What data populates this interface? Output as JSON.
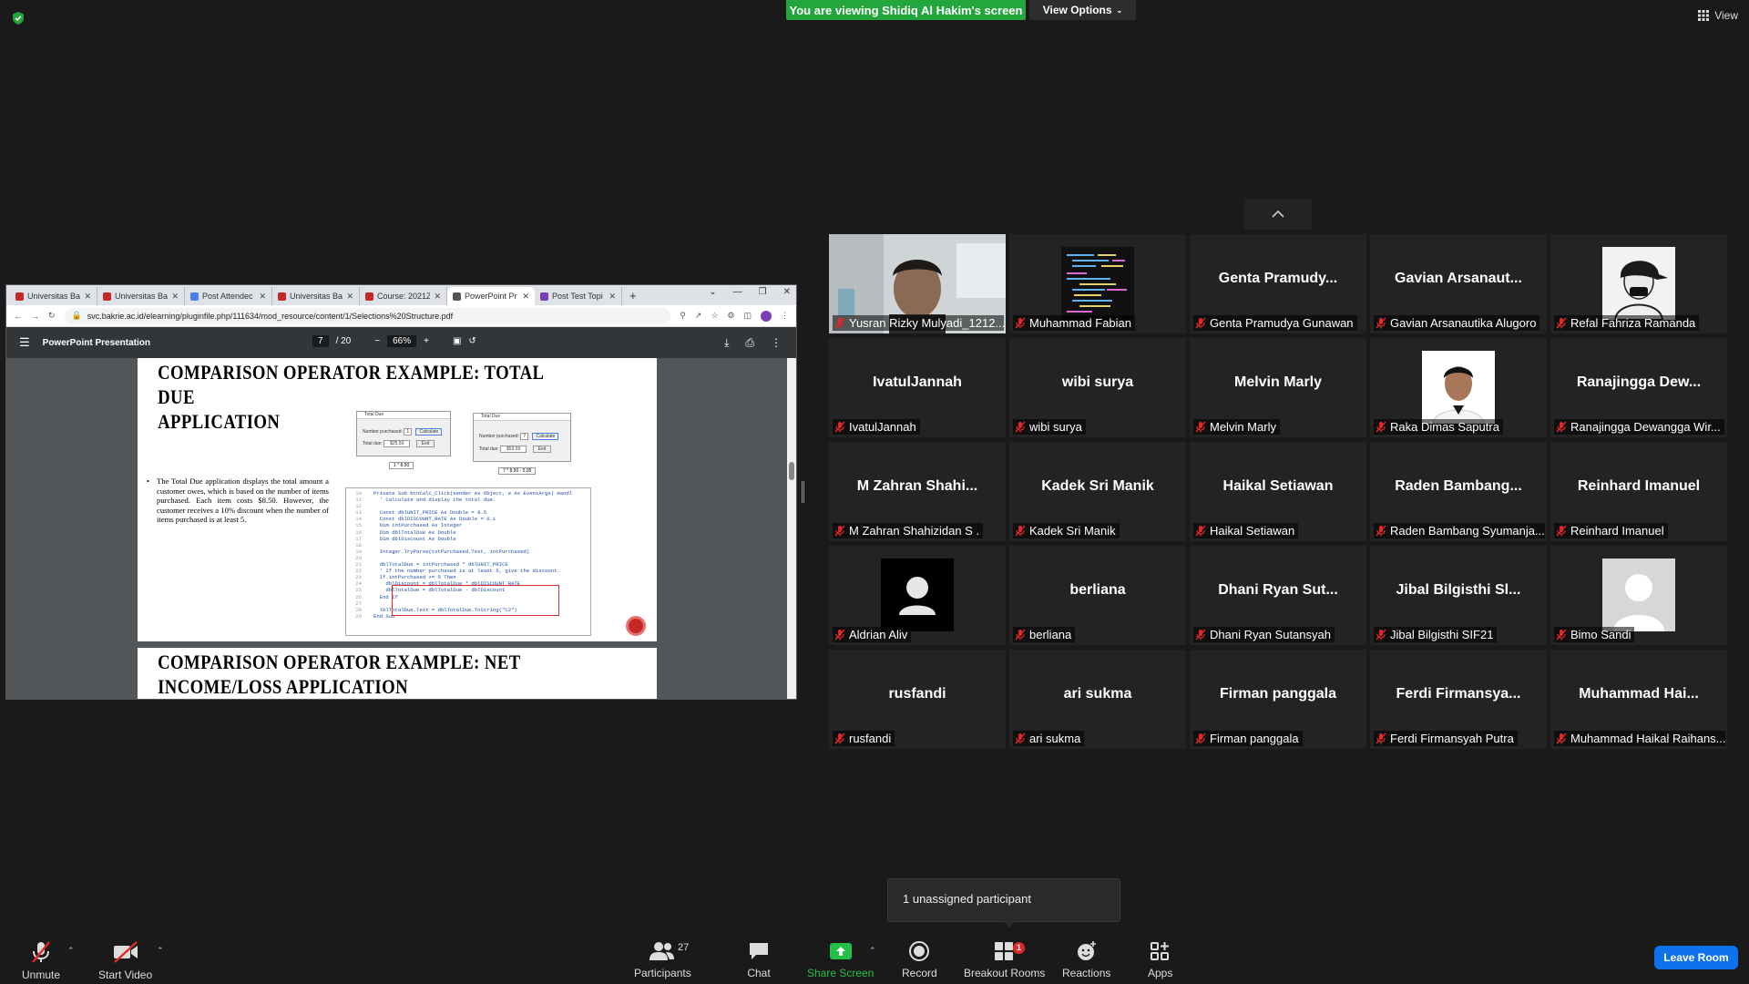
{
  "banner": {
    "viewing_text": "You are viewing Shidiq Al Hakim's screen",
    "view_options": "View Options"
  },
  "top_right": {
    "view_label": "View"
  },
  "browser": {
    "tabs": [
      {
        "label": "Universitas Ba",
        "color": "#c62828"
      },
      {
        "label": "Universitas Ba",
        "color": "#c62828"
      },
      {
        "label": "Post Attendec",
        "color": "#4a7ee8"
      },
      {
        "label": "Universitas Ba",
        "color": "#c62828"
      },
      {
        "label": "Course: 2021Z",
        "color": "#c62828"
      },
      {
        "label": "PowerPoint Pr",
        "color": "#555555"
      },
      {
        "label": "Post Test Topi",
        "color": "#7b3fb5"
      }
    ],
    "url": "svc.bakrie.ac.id/elearning/pluginfile.php/111634/mod_resource/content/1/Selections%20Structure.pdf"
  },
  "pdf": {
    "title": "PowerPoint Presentation",
    "page_current": "7",
    "page_total": "/ 20",
    "zoom": "66%",
    "slide1_title_1": "COMPARISON OPERATOR EXAMPLE: TOTAL DUE",
    "slide1_title_2": "APPLICATION",
    "bullet": "The Total Due application displays the total amount a customer owes, which is based on the number of items purchased. Each item costs $8.50. However, the customer receives a 10% discount when the number of items purchased is at least 5.",
    "dialog_title": "Total Due",
    "dialog_num_label": "Number purchased:",
    "dialog_due_label": "Total due:",
    "dialog_calc": "Calculate",
    "dialog_exit": "Exit",
    "dialog1_value": "1",
    "dialog1_due": "$25.50",
    "dialog2_value": "7",
    "dialog2_due": "$53.55",
    "caption1": "1 * 8.50",
    "caption2": "7 * 8.50 - 5.95",
    "code_line_numbers": "10\n11\n12\n13\n14\n15\n16\n17\n18\n19\n20\n21\n22\n23\n24\n25\n26\n27\n28\n29",
    "code": "Private Sub btnCalc_Click(sender As Object, e As EventArgs) Handl\n  ' Calculate and display the total due.\n\n  Const dblUNIT_PRICE As Double = 8.5\n  Const dblDISCOUNT_RATE As Double = 0.1\n  Dim intPurchased As Integer\n  Dim dblTotalDue As Double\n  Dim dblDiscount As Double\n\n  Integer.TryParse(txtPurchased.Text, intPurchased)\n\n  dblTotalDue = intPurchased * dblUNIT_PRICE\n  ' If the number purchased is at least 5, give the discount.\n  If intPurchased >= 5 Then\n    dblDiscount = dblTotalDue * dblDISCOUNT_RATE\n    dblTotalDue = dblTotalDue - dblDiscount\n  End If\n\n  lblTotalDue.Text = dblTotalDue.ToString(\"C2\")\nEnd Sub",
    "slide2_title_1": "COMPARISON OPERATOR EXAMPLE: NET",
    "slide2_title_2": "INCOME/LOSS APPLICATION"
  },
  "participants": [
    {
      "name": "",
      "label": "Yusran Rizky Mulyadi_1212...",
      "type": "video"
    },
    {
      "name": "",
      "label": "Muhammad Fabian",
      "type": "code"
    },
    {
      "name": "Genta Pramudy...",
      "label": "Genta Pramudya Gunawan",
      "type": "name"
    },
    {
      "name": "Gavian Arsanaut...",
      "label": "Gavian Arsanautika Alugoro",
      "type": "name"
    },
    {
      "name": "",
      "label": "Refal Fahriza Ramanda",
      "type": "cap"
    },
    {
      "name": "IvatulJannah",
      "label": "IvatulJannah",
      "type": "name"
    },
    {
      "name": "wibi surya",
      "label": "wibi surya",
      "type": "name"
    },
    {
      "name": "Melvin Marly",
      "label": "Melvin Marly",
      "type": "name"
    },
    {
      "name": "",
      "label": "Raka Dimas Saputra",
      "type": "photo"
    },
    {
      "name": "Ranajingga Dew...",
      "label": "Ranajingga Dewangga Wir...",
      "type": "name"
    },
    {
      "name": "M Zahran Shahi...",
      "label": "M Zahran Shahizidan S .",
      "type": "name"
    },
    {
      "name": "Kadek Sri Manik",
      "label": "Kadek Sri Manik",
      "type": "name"
    },
    {
      "name": "Haikal Setiawan",
      "label": "Haikal Setiawan",
      "type": "name"
    },
    {
      "name": "Raden Bambang...",
      "label": "Raden Bambang Syumanja...",
      "type": "name"
    },
    {
      "name": "Reinhard Imanuel",
      "label": "Reinhard Imanuel",
      "type": "name"
    },
    {
      "name": "",
      "label": "Aldrian Aliv",
      "type": "avatar-dark"
    },
    {
      "name": "berliana",
      "label": "berliana",
      "type": "name"
    },
    {
      "name": "Dhani Ryan Sut...",
      "label": "Dhani Ryan Sutansyah",
      "type": "name"
    },
    {
      "name": "Jibal Bilgisthi Sl...",
      "label": "Jibal Bilgisthi SIF21",
      "type": "name"
    },
    {
      "name": "",
      "label": "Bimo Sandi",
      "type": "avatar-light"
    },
    {
      "name": "rusfandi",
      "label": "rusfandi",
      "type": "name"
    },
    {
      "name": "ari sukma",
      "label": "ari sukma",
      "type": "name"
    },
    {
      "name": "Firman panggala",
      "label": "Firman panggala",
      "type": "name"
    },
    {
      "name": "Ferdi Firmansya...",
      "label": "Ferdi Firmansyah Putra",
      "type": "name"
    },
    {
      "name": "Muhammad Hai...",
      "label": "Muhammad Haikal Raihans...",
      "type": "name"
    }
  ],
  "unassigned": "1 unassigned participant",
  "toolbar": {
    "unmute": "Unmute",
    "start_video": "Start Video",
    "participants": "Participants",
    "participants_count": "27",
    "chat": "Chat",
    "share_screen": "Share Screen",
    "record": "Record",
    "breakout_rooms": "Breakout Rooms",
    "breakout_badge": "1",
    "reactions": "Reactions",
    "apps": "Apps",
    "leave": "Leave Room"
  },
  "colors": {
    "banner": "#23a63c",
    "leave": "#0e72ed",
    "share_icon": "#23c048",
    "badge": "#e02828",
    "muted": "#e02828"
  }
}
